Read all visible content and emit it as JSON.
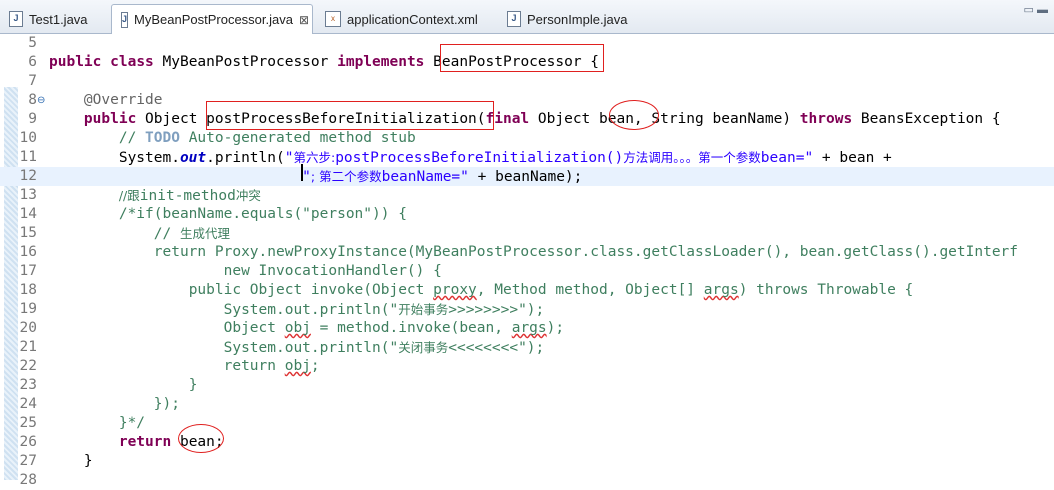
{
  "tabs": [
    {
      "label": "Test1.java",
      "icon": "java-file-icon"
    },
    {
      "label": "MyBeanPostProcessor.java",
      "icon": "java-file-icon",
      "active": true,
      "close": "⊠"
    },
    {
      "label": "applicationContext.xml",
      "icon": "xml-file-icon"
    },
    {
      "label": "PersonImple.java",
      "icon": "java-file-icon"
    }
  ],
  "window_controls": "▭ ▬",
  "lines": [
    {
      "n": "5",
      "parts": []
    },
    {
      "n": "6",
      "parts": [
        {
          "t": "public",
          "c": "kw"
        },
        {
          "t": " "
        },
        {
          "t": "class",
          "c": "kw"
        },
        {
          "t": " MyBeanPostProcessor "
        },
        {
          "t": "implements",
          "c": "kw"
        },
        {
          "t": " BeanPostProcessor {"
        }
      ]
    },
    {
      "n": "7",
      "parts": []
    },
    {
      "n": "8",
      "fold": "⊖",
      "parts": [
        {
          "t": "    "
        },
        {
          "t": "@Override",
          "c": "ann"
        }
      ]
    },
    {
      "n": "9",
      "parts": [
        {
          "t": "    "
        },
        {
          "t": "public",
          "c": "kw"
        },
        {
          "t": " Object postProcessBeforeInitialization("
        },
        {
          "t": "final",
          "c": "kw"
        },
        {
          "t": " Object bean, String beanName) "
        },
        {
          "t": "throws",
          "c": "kw"
        },
        {
          "t": " BeansException {"
        }
      ]
    },
    {
      "n": "10",
      "parts": [
        {
          "t": "        "
        },
        {
          "t": "// ",
          "c": "cm"
        },
        {
          "t": "TODO",
          "c": "todo"
        },
        {
          "t": " Auto-generated method stub",
          "c": "cm"
        }
      ]
    },
    {
      "n": "11",
      "parts": [
        {
          "t": "        System."
        },
        {
          "t": "out",
          "c": "fld"
        },
        {
          "t": ".println("
        },
        {
          "t": "\"",
          "c": "str"
        },
        {
          "t": "第六步:",
          "c": "str cn"
        },
        {
          "t": "postProcessBeforeInitialization()",
          "c": "str"
        },
        {
          "t": "方法调用。。。第一个参数",
          "c": "str cn"
        },
        {
          "t": "bean=\"",
          "c": "str"
        },
        {
          "t": " + bean +"
        }
      ]
    },
    {
      "n": "12",
      "cur": true,
      "parts": [
        {
          "t": "                             "
        },
        {
          "t": "\"",
          "c": "str"
        },
        {
          "t": "; 第二个参数",
          "c": "str cn"
        },
        {
          "t": "beanName=\"",
          "c": "str"
        },
        {
          "t": " + beanName);"
        }
      ]
    },
    {
      "n": "13",
      "parts": [
        {
          "t": "        "
        },
        {
          "t": "//跟",
          "c": "cm cn"
        },
        {
          "t": "init-method",
          "c": "cm"
        },
        {
          "t": "冲突",
          "c": "cm cn"
        }
      ]
    },
    {
      "n": "14",
      "parts": [
        {
          "t": "        "
        },
        {
          "t": "/*if(beanName.equals(\"person\")) {",
          "c": "cm"
        }
      ]
    },
    {
      "n": "15",
      "parts": [
        {
          "t": "            "
        },
        {
          "t": "// ",
          "c": "cm"
        },
        {
          "t": "生成代理",
          "c": "cm cn"
        }
      ]
    },
    {
      "n": "16",
      "parts": [
        {
          "t": "            "
        },
        {
          "t": "return Proxy.newProxyInstance(MyBeanPostProcessor.class.getClassLoader(), bean.getClass().getInterf",
          "c": "cm"
        }
      ]
    },
    {
      "n": "17",
      "parts": [
        {
          "t": "                    "
        },
        {
          "t": "new InvocationHandler() {",
          "c": "cm"
        }
      ]
    },
    {
      "n": "18",
      "parts": [
        {
          "t": "                "
        },
        {
          "t": "public Object invoke(Object ",
          "c": "cm"
        },
        {
          "t": "proxy",
          "c": "cm wavy"
        },
        {
          "t": ", Method method, Object[] ",
          "c": "cm"
        },
        {
          "t": "args",
          "c": "cm wavy"
        },
        {
          "t": ") throws Throwable {",
          "c": "cm"
        }
      ]
    },
    {
      "n": "19",
      "parts": [
        {
          "t": "                    "
        },
        {
          "t": "System.out.println(\"",
          "c": "cm"
        },
        {
          "t": "开始事务",
          "c": "cm cn"
        },
        {
          "t": ">>>>>>>>\");",
          "c": "cm"
        }
      ]
    },
    {
      "n": "20",
      "parts": [
        {
          "t": "                    "
        },
        {
          "t": "Object ",
          "c": "cm"
        },
        {
          "t": "obj",
          "c": "cm wavy"
        },
        {
          "t": " = method.invoke(bean, ",
          "c": "cm"
        },
        {
          "t": "args",
          "c": "cm wavy"
        },
        {
          "t": ");",
          "c": "cm"
        }
      ]
    },
    {
      "n": "21",
      "parts": [
        {
          "t": "                    "
        },
        {
          "t": "System.out.println(\"",
          "c": "cm"
        },
        {
          "t": "关闭事务",
          "c": "cm cn"
        },
        {
          "t": "<<<<<<<<\");",
          "c": "cm"
        }
      ]
    },
    {
      "n": "22",
      "parts": [
        {
          "t": "                    "
        },
        {
          "t": "return ",
          "c": "cm"
        },
        {
          "t": "obj",
          "c": "cm wavy"
        },
        {
          "t": ";",
          "c": "cm"
        }
      ]
    },
    {
      "n": "23",
      "parts": [
        {
          "t": "                "
        },
        {
          "t": "}",
          "c": "cm"
        }
      ]
    },
    {
      "n": "24",
      "parts": [
        {
          "t": "            "
        },
        {
          "t": "});",
          "c": "cm"
        }
      ]
    },
    {
      "n": "25",
      "parts": [
        {
          "t": "        "
        },
        {
          "t": "}*/",
          "c": "cm"
        }
      ]
    },
    {
      "n": "26",
      "parts": [
        {
          "t": "        "
        },
        {
          "t": "return",
          "c": "kw"
        },
        {
          "t": " bean;"
        }
      ]
    },
    {
      "n": "27",
      "parts": [
        {
          "t": "    }"
        }
      ]
    },
    {
      "n": "28",
      "parts": []
    }
  ]
}
